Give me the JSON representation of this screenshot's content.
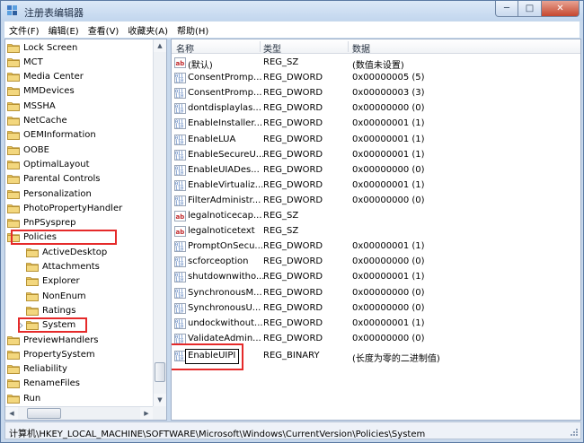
{
  "window": {
    "title": "注册表编辑器"
  },
  "menu": [
    "文件(F)",
    "编辑(E)",
    "查看(V)",
    "收藏夹(A)",
    "帮助(H)"
  ],
  "tree": {
    "items": [
      {
        "label": "Lock Screen",
        "level": 0
      },
      {
        "label": "MCT",
        "level": 0
      },
      {
        "label": "Media Center",
        "level": 0
      },
      {
        "label": "MMDevices",
        "level": 0
      },
      {
        "label": "MSSHA",
        "level": 0
      },
      {
        "label": "NetCache",
        "level": 0
      },
      {
        "label": "OEMInformation",
        "level": 0
      },
      {
        "label": "OOBE",
        "level": 0
      },
      {
        "label": "OptimalLayout",
        "level": 0
      },
      {
        "label": "Parental Controls",
        "level": 0
      },
      {
        "label": "Personalization",
        "level": 0
      },
      {
        "label": "PhotoPropertyHandler",
        "level": 0
      },
      {
        "label": "PnPSysprep",
        "level": 0
      },
      {
        "label": "Policies",
        "level": 0,
        "highlighted": true
      },
      {
        "label": "ActiveDesktop",
        "level": 1
      },
      {
        "label": "Attachments",
        "level": 1
      },
      {
        "label": "Explorer",
        "level": 1
      },
      {
        "label": "NonEnum",
        "level": 1
      },
      {
        "label": "Ratings",
        "level": 1
      },
      {
        "label": "System",
        "level": 1,
        "highlighted": true,
        "selected": true
      },
      {
        "label": "PreviewHandlers",
        "level": 0
      },
      {
        "label": "PropertySystem",
        "level": 0
      },
      {
        "label": "Reliability",
        "level": 0
      },
      {
        "label": "RenameFiles",
        "level": 0
      },
      {
        "label": "Run",
        "level": 0
      }
    ]
  },
  "list": {
    "columns": [
      "名称",
      "类型",
      "数据"
    ],
    "rows": [
      {
        "icon": "string-value-icon",
        "name": "(默认)",
        "type": "REG_SZ",
        "data": "(数值未设置)"
      },
      {
        "icon": "binary-value-icon",
        "name": "ConsentPromp...",
        "type": "REG_DWORD",
        "data": "0x00000005 (5)"
      },
      {
        "icon": "binary-value-icon",
        "name": "ConsentPromp...",
        "type": "REG_DWORD",
        "data": "0x00000003 (3)"
      },
      {
        "icon": "binary-value-icon",
        "name": "dontdisplaylas...",
        "type": "REG_DWORD",
        "data": "0x00000000 (0)"
      },
      {
        "icon": "binary-value-icon",
        "name": "EnableInstaller...",
        "type": "REG_DWORD",
        "data": "0x00000001 (1)"
      },
      {
        "icon": "binary-value-icon",
        "name": "EnableLUA",
        "type": "REG_DWORD",
        "data": "0x00000001 (1)"
      },
      {
        "icon": "binary-value-icon",
        "name": "EnableSecureU...",
        "type": "REG_DWORD",
        "data": "0x00000001 (1)"
      },
      {
        "icon": "binary-value-icon",
        "name": "EnableUIADes...",
        "type": "REG_DWORD",
        "data": "0x00000000 (0)"
      },
      {
        "icon": "binary-value-icon",
        "name": "EnableVirtualiz...",
        "type": "REG_DWORD",
        "data": "0x00000001 (1)"
      },
      {
        "icon": "binary-value-icon",
        "name": "FilterAdministr...",
        "type": "REG_DWORD",
        "data": "0x00000000 (0)"
      },
      {
        "icon": "string-value-icon",
        "name": "legalnoticecap...",
        "type": "REG_SZ",
        "data": ""
      },
      {
        "icon": "string-value-icon",
        "name": "legalnoticetext",
        "type": "REG_SZ",
        "data": ""
      },
      {
        "icon": "binary-value-icon",
        "name": "PromptOnSecu...",
        "type": "REG_DWORD",
        "data": "0x00000001 (1)"
      },
      {
        "icon": "binary-value-icon",
        "name": "scforceoption",
        "type": "REG_DWORD",
        "data": "0x00000000 (0)"
      },
      {
        "icon": "binary-value-icon",
        "name": "shutdownwitho...",
        "type": "REG_DWORD",
        "data": "0x00000001 (1)"
      },
      {
        "icon": "binary-value-icon",
        "name": "SynchronousM...",
        "type": "REG_DWORD",
        "data": "0x00000000 (0)"
      },
      {
        "icon": "binary-value-icon",
        "name": "SynchronousU...",
        "type": "REG_DWORD",
        "data": "0x00000000 (0)"
      },
      {
        "icon": "binary-value-icon",
        "name": "undockwithout...",
        "type": "REG_DWORD",
        "data": "0x00000001 (1)"
      },
      {
        "icon": "binary-value-icon",
        "name": "ValidateAdmin...",
        "type": "REG_DWORD",
        "data": "0x00000000 (0)"
      },
      {
        "icon": "binary-value-icon",
        "name": "EnableUIPI",
        "type": "REG_BINARY",
        "data": "(长度为零的二进制值)",
        "editing": true,
        "highlighted": true
      }
    ]
  },
  "status": {
    "path": "计算机\\HKEY_LOCAL_MACHINE\\SOFTWARE\\Microsoft\\Windows\\CurrentVersion\\Policies\\System"
  },
  "colors": {
    "highlight_border": "#e52a2a",
    "folder": "#e8c25a"
  }
}
